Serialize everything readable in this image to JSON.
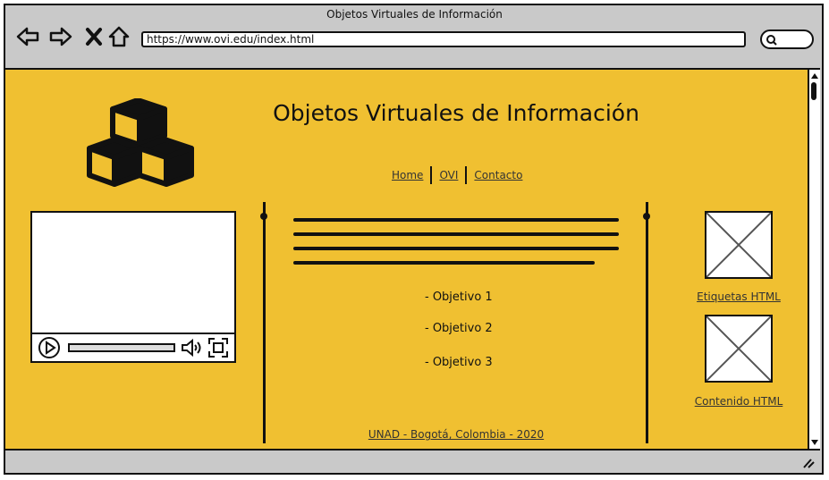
{
  "window": {
    "title": "Objetos Virtuales de Información"
  },
  "toolbar": {
    "url": "https://www.ovi.edu/index.html",
    "back_icon": "arrow-left-icon",
    "forward_icon": "arrow-right-icon",
    "stop_icon": "close-icon",
    "home_icon": "home-icon",
    "search_icon": "search-icon"
  },
  "page": {
    "heading": "Objetos Virtuales de Información",
    "nav": [
      "Home",
      "OVI",
      "Contacto"
    ],
    "objectives": [
      "- Objetivo 1",
      "- Objetivo 2",
      "- Objetivo 3"
    ],
    "right_links": [
      "Etiquetas HTML",
      "Contenido HTML"
    ],
    "footer": "UNAD - Bogotá, Colombia - 2020"
  },
  "colors": {
    "content_bg": "#f0c031",
    "chrome_bg": "#c9c9c9"
  }
}
